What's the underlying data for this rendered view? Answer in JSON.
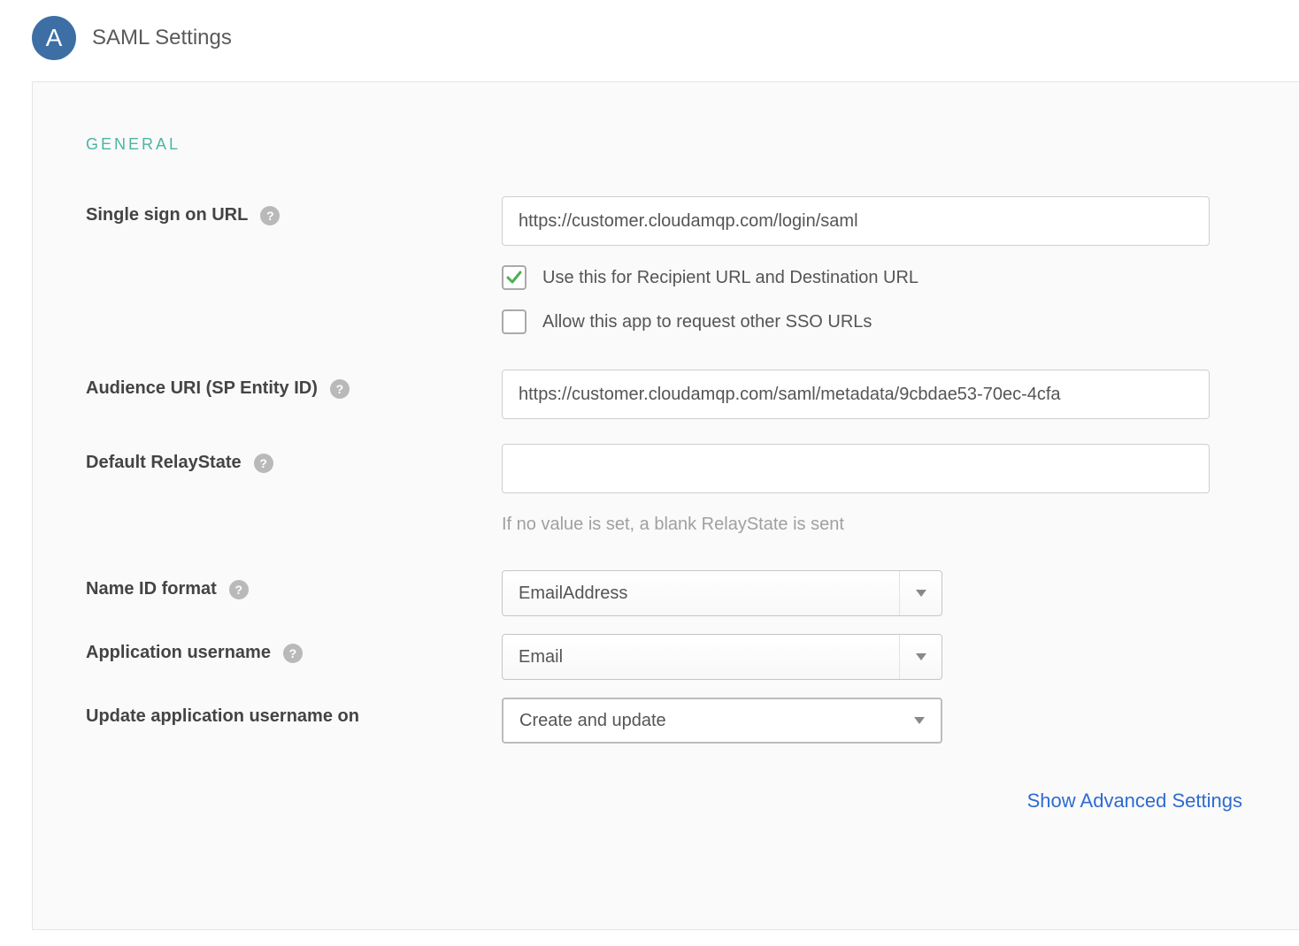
{
  "header": {
    "badge_letter": "A",
    "title": "SAML Settings"
  },
  "section": {
    "title": "General"
  },
  "fields": {
    "sso_url": {
      "label": "Single sign on URL",
      "value": "https://customer.cloudamqp.com/login/saml",
      "cb_recipient": {
        "checked": true,
        "label": "Use this for Recipient URL and Destination URL"
      },
      "cb_allow_other": {
        "checked": false,
        "label": "Allow this app to request other SSO URLs"
      }
    },
    "audience_uri": {
      "label": "Audience URI (SP Entity ID)",
      "value": "https://customer.cloudamqp.com/saml/metadata/9cbdae53-70ec-4cfa"
    },
    "relay_state": {
      "label": "Default RelayState",
      "value": "",
      "hint": "If no value is set, a blank RelayState is sent"
    },
    "name_id_format": {
      "label": "Name ID format",
      "value": "EmailAddress"
    },
    "app_username": {
      "label": "Application username",
      "value": "Email"
    },
    "update_on": {
      "label": "Update application username on",
      "value": "Create and update"
    }
  },
  "links": {
    "advanced": "Show Advanced Settings"
  }
}
